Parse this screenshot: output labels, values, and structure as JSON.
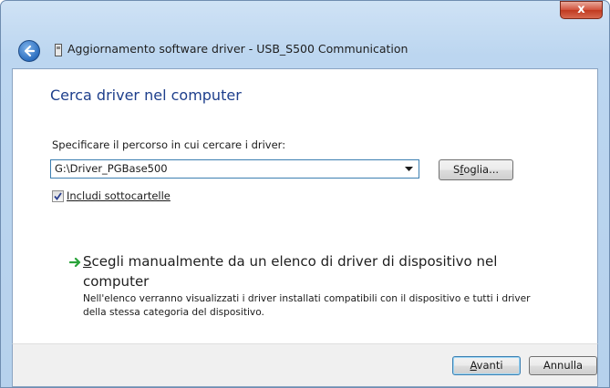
{
  "window": {
    "close_label": "x",
    "title": "Aggiornamento software driver - USB_S500 Communication"
  },
  "page": {
    "heading": "Cerca driver nel computer",
    "path_label": "Specificare il percorso in cui cercare i driver:",
    "path_value": "G:\\Driver_PGBase500",
    "browse_prefix": "S",
    "browse_accel": "f",
    "browse_suffix": "oglia...",
    "include_subfolders_label": "Includi sottocartelle",
    "include_subfolders_checked": true
  },
  "manual_option": {
    "title_accel": "S",
    "title_rest": "cegli manualmente da un elenco di driver di dispositivo nel computer",
    "description": "Nell'elenco verranno visualizzati i driver installati compatibili con il dispositivo e tutti i driver della stessa categoria del dispositivo."
  },
  "footer": {
    "next_accel": "A",
    "next_rest": "vanti",
    "cancel_label": "Annulla"
  },
  "icons": {
    "back": "back-arrow-icon",
    "title": "device-icon",
    "dropdown": "dropdown-arrow-icon",
    "checkmark": "checkmark-icon",
    "link_arrow": "green-arrow-icon"
  },
  "colors": {
    "heading": "#1e3f8c",
    "link_arrow": "#2aa33a",
    "close_button": "#c7462b"
  }
}
